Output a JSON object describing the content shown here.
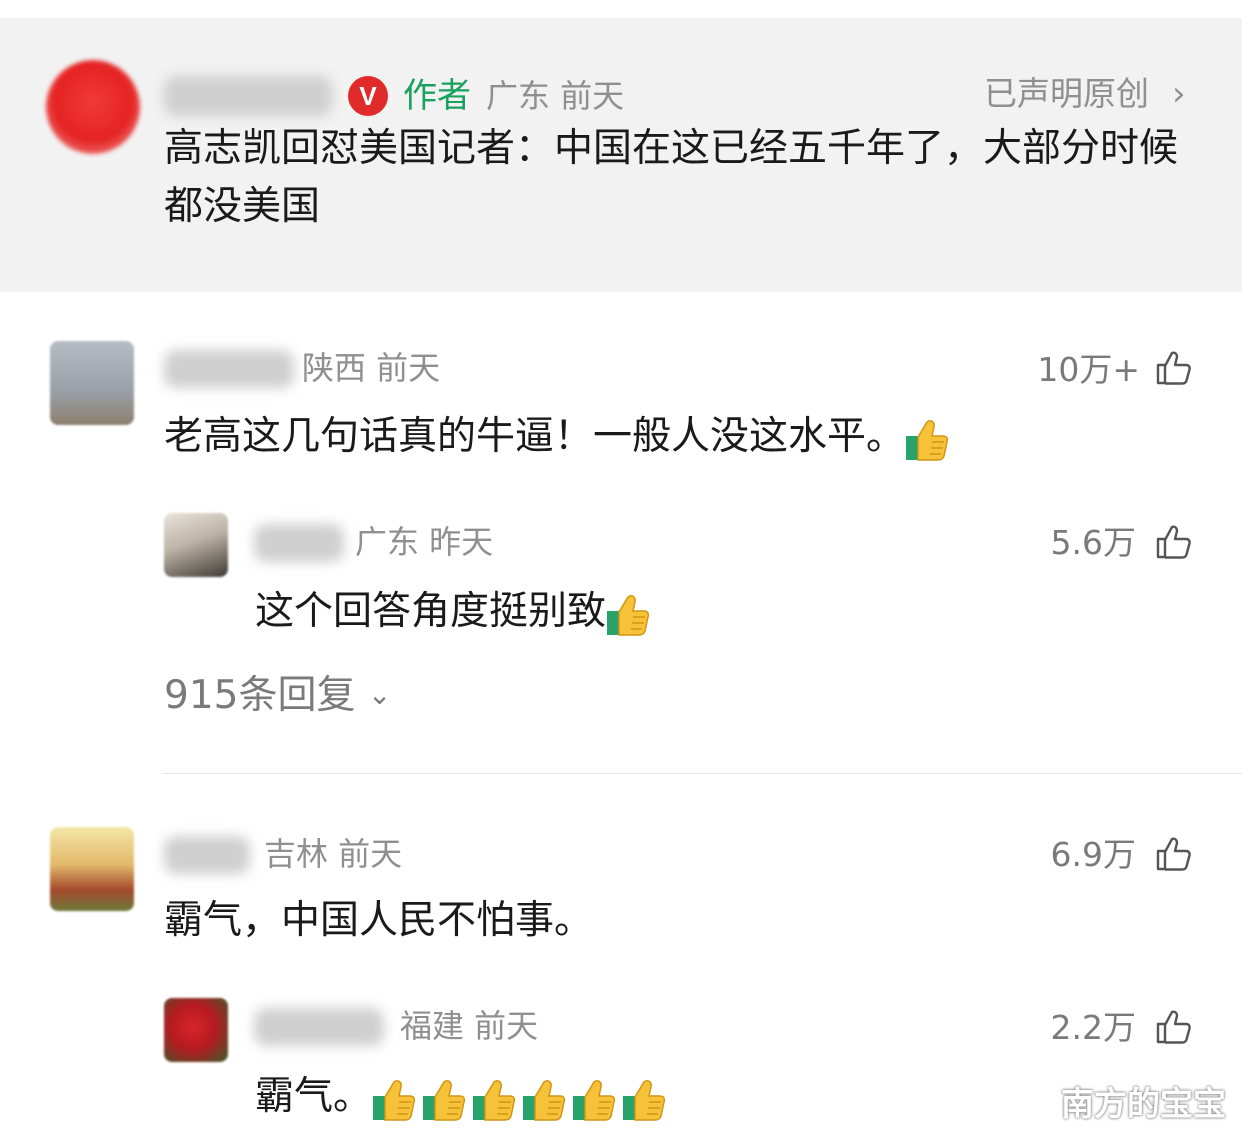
{
  "author_post": {
    "name_blurred": "",
    "verified_badge": "V",
    "author_tag": "作者",
    "meta": "广东 前天",
    "original_claim": "已声明原创",
    "text": "高志凯回怼美国记者：中国在这已经五千年了，大部分时候都没美国"
  },
  "comments": [
    {
      "meta": "陕西 前天",
      "likes": "10万+",
      "text": "老高这几句话真的牛逼！一般人没这水平。",
      "emoji_count": 1,
      "reply": {
        "meta": "广东 昨天",
        "likes": "5.6万",
        "text": "这个回答角度挺别致",
        "emoji_count": 1
      },
      "more_replies": "915条回复"
    },
    {
      "meta": "吉林 前天",
      "likes": "6.9万",
      "text": "霸气，中国人民不怕事。",
      "emoji_count": 0,
      "reply": {
        "meta": "福建 前天",
        "likes": "2.2万",
        "text": "霸气。",
        "emoji_count": 6
      }
    }
  ],
  "watermark": "南方的宝宝",
  "icons": {
    "like": "thumbs-up-outline-icon",
    "emoji": "thumbs-up-emoji-icon",
    "chevron": "chevron-right-icon",
    "expand": "chevron-down-icon"
  },
  "colors": {
    "author_green": "#19a15f",
    "badge_red": "#e12a2a",
    "meta_gray": "#8f8f8f",
    "text_dark": "#1a1a1a"
  }
}
